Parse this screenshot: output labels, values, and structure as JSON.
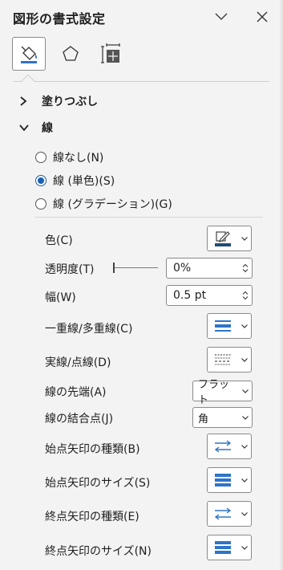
{
  "pane": {
    "title": "図形の書式設定",
    "collapse_icon": "chevron-down-icon",
    "close_icon": "close-icon"
  },
  "tabs": [
    {
      "name": "fill-and-line",
      "icon": "paint-bucket-icon",
      "active": true
    },
    {
      "name": "effects",
      "icon": "pentagon-icon",
      "active": false
    },
    {
      "name": "size-and-properties",
      "icon": "size-properties-icon",
      "active": false
    }
  ],
  "sections": {
    "fill": {
      "label": "塗りつぶし",
      "expanded": false
    },
    "line": {
      "label": "線",
      "expanded": true
    }
  },
  "line_options": [
    {
      "label": "線なし(N)",
      "checked": false
    },
    {
      "label": "線 (単色)(S)",
      "checked": true
    },
    {
      "label": "線 (グラデーション)(G)",
      "checked": false
    }
  ],
  "properties": {
    "color": {
      "label": "色(C)",
      "swatch_color": "#1e4e79"
    },
    "transparency": {
      "label": "透明度(T)",
      "value": "0%"
    },
    "width": {
      "label": "幅(W)",
      "value": "0.5 pt"
    },
    "compound": {
      "label": "一重線/多重線(C)"
    },
    "dash": {
      "label": "実線/点線(D)"
    },
    "cap": {
      "label": "線の先端(A)",
      "value": "フラット"
    },
    "join": {
      "label": "線の結合点(J)",
      "value": "角"
    },
    "begin_arrow_type": {
      "label": "始点矢印の種類(B)"
    },
    "begin_arrow_size": {
      "label": "始点矢印のサイズ(S)"
    },
    "end_arrow_type": {
      "label": "終点矢印の種類(E)"
    },
    "end_arrow_size": {
      "label": "終点矢印のサイズ(N)"
    }
  },
  "colors": {
    "accent": "#1a5fb4",
    "icon_blue": "#2e74c9",
    "background": "#f3f3f3"
  }
}
